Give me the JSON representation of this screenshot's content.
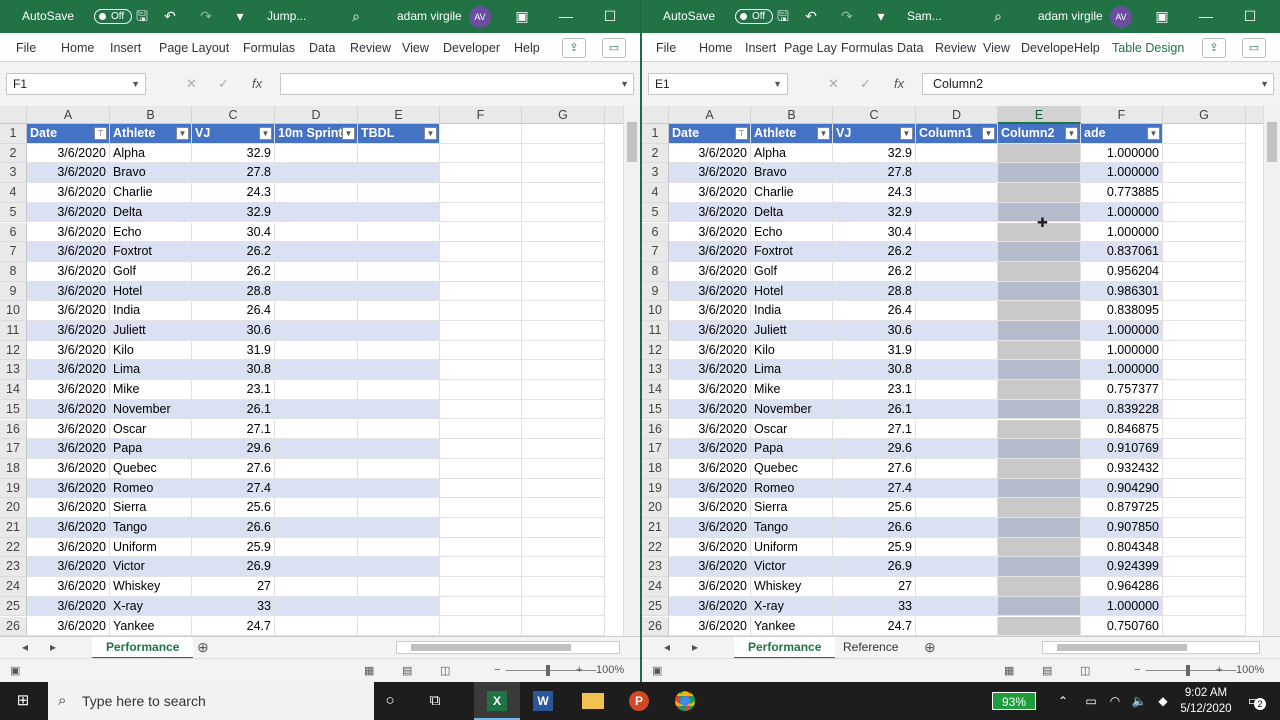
{
  "left": {
    "autosave_label": "AutoSave",
    "autosave_state": "Off",
    "file_name": "Jump...",
    "user_name": "adam virgile",
    "avatar": "AV",
    "menu": [
      "File",
      "Home",
      "Insert",
      "Page Layout",
      "Formulas",
      "Data",
      "Review",
      "View",
      "Developer",
      "Help"
    ],
    "name_box": "F1",
    "formula": "",
    "zoom": "100%",
    "columns": [
      "A",
      "B",
      "C",
      "D",
      "E",
      "F",
      "G"
    ],
    "headers": [
      "Date",
      "Athlete",
      "VJ",
      "10m Sprint",
      "TBDL"
    ],
    "sheet_tabs": [
      "Performance"
    ]
  },
  "right": {
    "autosave_label": "AutoSave",
    "autosave_state": "Off",
    "file_name": "Sam...",
    "user_name": "adam virgile",
    "avatar": "AV",
    "menu": [
      "File",
      "Home",
      "Insert",
      "Page Lay",
      "Formulas",
      "Data",
      "Review",
      "View",
      "Develope",
      "Help",
      "Table Design"
    ],
    "name_box": "E1",
    "formula": "Column2",
    "zoom": "100%",
    "columns": [
      "A",
      "B",
      "C",
      "D",
      "E",
      "F",
      "G"
    ],
    "headers": [
      "Date",
      "Athlete",
      "VJ",
      "Column1",
      "Column2",
      "ade"
    ],
    "sheet_tabs": [
      "Performance",
      "Reference"
    ]
  },
  "row_numbers": [
    "1",
    "2",
    "3",
    "4",
    "5",
    "6",
    "7",
    "8",
    "9",
    "10",
    "11",
    "12",
    "13",
    "14",
    "15",
    "16",
    "17",
    "18",
    "19",
    "20",
    "21",
    "22",
    "23",
    "24",
    "25",
    "26"
  ],
  "rows": [
    {
      "date": "3/6/2020",
      "athlete": "Alpha",
      "vj": "32.9",
      "f": "1.000000"
    },
    {
      "date": "3/6/2020",
      "athlete": "Bravo",
      "vj": "27.8",
      "f": "1.000000"
    },
    {
      "date": "3/6/2020",
      "athlete": "Charlie",
      "vj": "24.3",
      "f": "0.773885"
    },
    {
      "date": "3/6/2020",
      "athlete": "Delta",
      "vj": "32.9",
      "f": "1.000000"
    },
    {
      "date": "3/6/2020",
      "athlete": "Echo",
      "vj": "30.4",
      "f": "1.000000"
    },
    {
      "date": "3/6/2020",
      "athlete": "Foxtrot",
      "vj": "26.2",
      "f": "0.837061"
    },
    {
      "date": "3/6/2020",
      "athlete": "Golf",
      "vj": "26.2",
      "f": "0.956204"
    },
    {
      "date": "3/6/2020",
      "athlete": "Hotel",
      "vj": "28.8",
      "f": "0.986301"
    },
    {
      "date": "3/6/2020",
      "athlete": "India",
      "vj": "26.4",
      "f": "0.838095"
    },
    {
      "date": "3/6/2020",
      "athlete": "Juliett",
      "vj": "30.6",
      "f": "1.000000"
    },
    {
      "date": "3/6/2020",
      "athlete": "Kilo",
      "vj": "31.9",
      "f": "1.000000"
    },
    {
      "date": "3/6/2020",
      "athlete": "Lima",
      "vj": "30.8",
      "f": "1.000000"
    },
    {
      "date": "3/6/2020",
      "athlete": "Mike",
      "vj": "23.1",
      "f": "0.757377"
    },
    {
      "date": "3/6/2020",
      "athlete": "November",
      "vj": "26.1",
      "f": "0.839228"
    },
    {
      "date": "3/6/2020",
      "athlete": "Oscar",
      "vj": "27.1",
      "f": "0.846875"
    },
    {
      "date": "3/6/2020",
      "athlete": "Papa",
      "vj": "29.6",
      "f": "0.910769"
    },
    {
      "date": "3/6/2020",
      "athlete": "Quebec",
      "vj": "27.6",
      "f": "0.932432"
    },
    {
      "date": "3/6/2020",
      "athlete": "Romeo",
      "vj": "27.4",
      "f": "0.904290"
    },
    {
      "date": "3/6/2020",
      "athlete": "Sierra",
      "vj": "25.6",
      "f": "0.879725"
    },
    {
      "date": "3/6/2020",
      "athlete": "Tango",
      "vj": "26.6",
      "f": "0.907850"
    },
    {
      "date": "3/6/2020",
      "athlete": "Uniform",
      "vj": "25.9",
      "f": "0.804348"
    },
    {
      "date": "3/6/2020",
      "athlete": "Victor",
      "vj": "26.9",
      "f": "0.924399"
    },
    {
      "date": "3/6/2020",
      "athlete": "Whiskey",
      "vj": "27",
      "f": "0.964286"
    },
    {
      "date": "3/6/2020",
      "athlete": "X-ray",
      "vj": "33",
      "f": "1.000000"
    },
    {
      "date": "3/6/2020",
      "athlete": "Yankee",
      "vj": "24.7",
      "f": "0.750760"
    }
  ],
  "taskbar": {
    "search_placeholder": "Type here to search",
    "battery": "93%",
    "time": "9:02 AM",
    "date": "5/12/2020",
    "notification_count": "2"
  },
  "colors": {
    "excel_green": "#217346",
    "table_header": "#4472c4",
    "band": "#d9e1f2"
  }
}
